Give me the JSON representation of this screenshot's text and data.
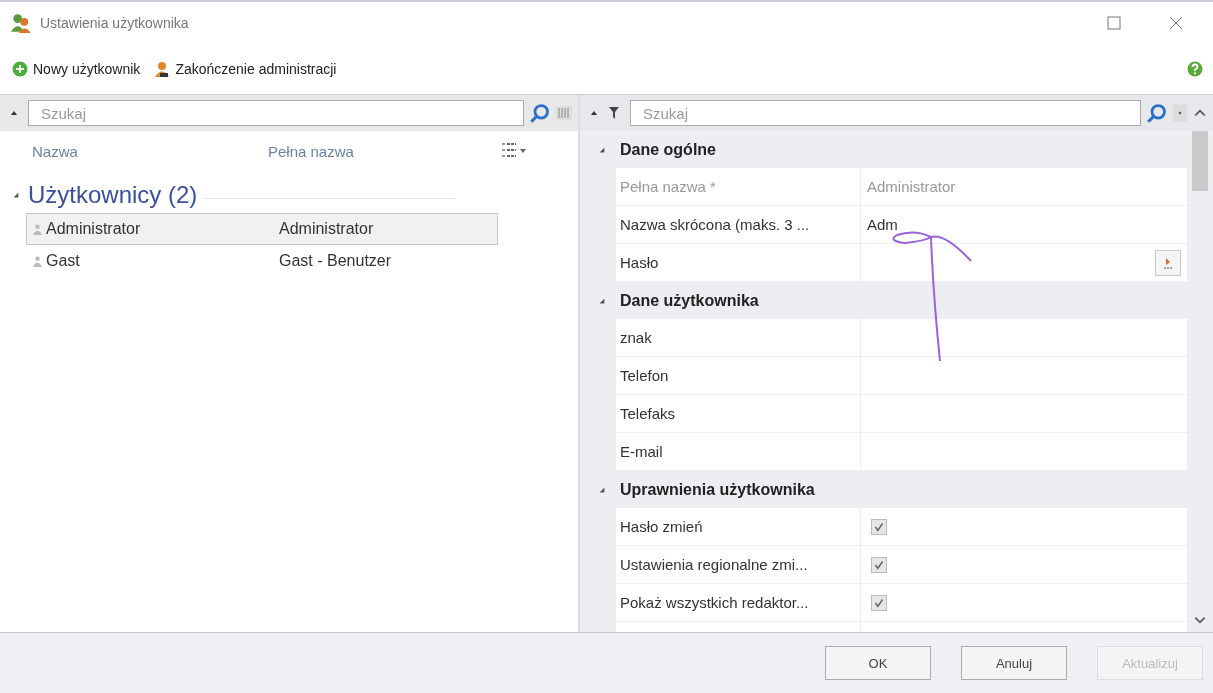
{
  "window": {
    "title": "Ustawienia użytkownika"
  },
  "toolbar": [
    {
      "label": "Nowy użytkownik",
      "kind": "add"
    },
    {
      "label": "Zakończenie administracji",
      "kind": "admin"
    }
  ],
  "users_panel": {
    "search": {
      "placeholder": "Szukaj"
    },
    "columns": [
      "Nazwa",
      "Pełna nazwa"
    ],
    "group": {
      "label": "Użytkownicy (2)",
      "expanded": true
    },
    "rows": [
      {
        "name": "Administrator",
        "full_name": "Administrator",
        "selected": true
      },
      {
        "name": "Gast",
        "full_name": "Gast - Benutzer",
        "selected": false
      }
    ]
  },
  "properties_panel": {
    "search": {
      "placeholder": "Szukaj"
    },
    "sections": [
      {
        "title": "Dane ogólne",
        "expanded": true,
        "rows": [
          {
            "kind": "text",
            "label": "Pełna nazwa *",
            "value": "Administrator",
            "disabled": true
          },
          {
            "kind": "text",
            "label": "Nazwa skrócona (maks. 3 ...",
            "value": "Adm",
            "disabled": false
          },
          {
            "kind": "button",
            "label": "Hasło",
            "disabled": false
          }
        ]
      },
      {
        "title": "Dane użytkownika",
        "expanded": true,
        "rows": [
          {
            "kind": "text",
            "label": "znak",
            "disabled": false
          },
          {
            "kind": "text",
            "label": "Telefon",
            "disabled": false
          },
          {
            "kind": "text",
            "label": "Telefaks",
            "disabled": false
          },
          {
            "kind": "text",
            "label": "E-mail",
            "disabled": false
          }
        ]
      },
      {
        "title": "Uprawnienia użytkownika",
        "expanded": true,
        "rows": [
          {
            "kind": "checkbox",
            "label": "Hasło zmień",
            "checked": true
          },
          {
            "kind": "checkbox",
            "label": "Ustawienia regionalne zmi...",
            "checked": true
          },
          {
            "kind": "checkbox",
            "label": "Pokaż wszystkich redaktor...",
            "checked": true
          }
        ]
      }
    ]
  },
  "buttons": [
    {
      "label": "OK",
      "disabled": false
    },
    {
      "label": "Anuluj",
      "disabled": false
    },
    {
      "label": "Aktualizuj",
      "disabled": true
    }
  ]
}
